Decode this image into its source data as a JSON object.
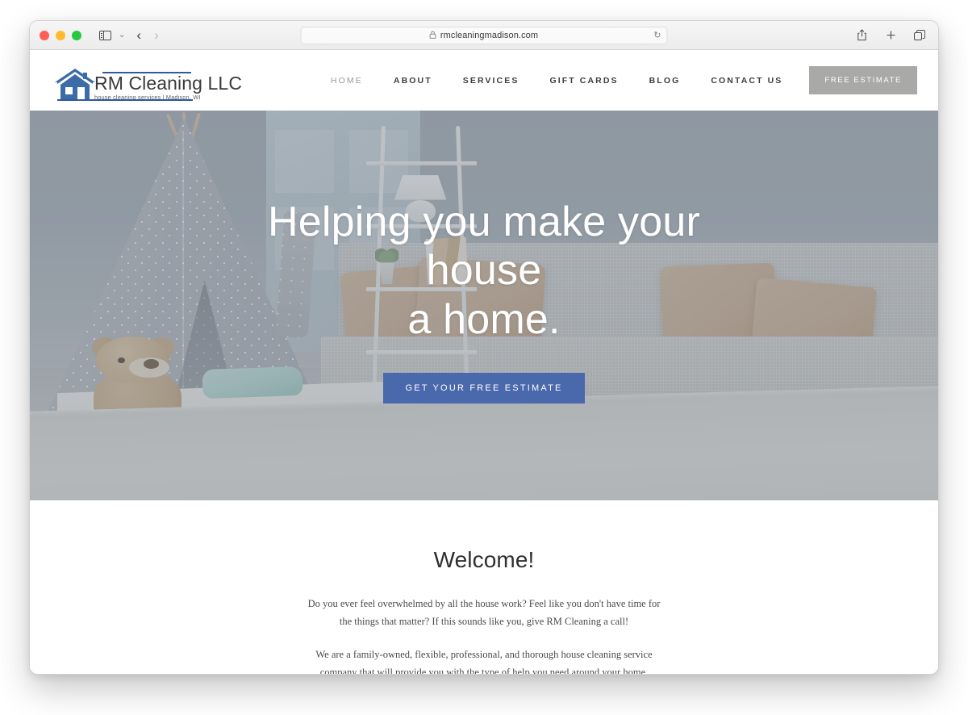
{
  "browser": {
    "traffic_lights": [
      "close",
      "minimize",
      "maximize"
    ],
    "sidebar_icon": "sidebar-icon",
    "chevron_icon": "chevron-down-icon",
    "back_label": "‹",
    "forward_label": "›",
    "lock_icon": "🔒",
    "url": "rmcleaningmadison.com",
    "reload_label": "↻",
    "share_label": "⇧",
    "new_tab_label": "+",
    "tabs_label": "⧉"
  },
  "site": {
    "logo": {
      "title": "RM Cleaning LLC",
      "tagline": "house cleaning services | Madison, WI",
      "icon": "house-icon",
      "brand_color": "#2f5a9e"
    },
    "nav": [
      {
        "label": "HOME",
        "active": true
      },
      {
        "label": "ABOUT",
        "active": false
      },
      {
        "label": "SERVICES",
        "active": false
      },
      {
        "label": "GIFT CARDS",
        "active": false
      },
      {
        "label": "BLOG",
        "active": false
      },
      {
        "label": "CONTACT US",
        "active": false
      }
    ],
    "header_cta": {
      "label": "FREE ESTIMATE",
      "bg": "#a9a9a7"
    }
  },
  "hero": {
    "title_line1": "Helping you make your house",
    "title_line2": "a home.",
    "cta_label": "GET YOUR FREE ESTIMATE",
    "cta_color": "#4a68ac",
    "overlay_color": "rgba(134,140,148,0.47)"
  },
  "welcome": {
    "title": "Welcome!",
    "paragraph1": "Do you ever feel overwhelmed by all the house work? Feel like you don't have time for the things that matter? If this sounds like you, give RM Cleaning a call!",
    "paragraph2": "We are a family-owned, flexible, professional, and thorough house cleaning service company that will provide you with the type of help you need around your home."
  }
}
